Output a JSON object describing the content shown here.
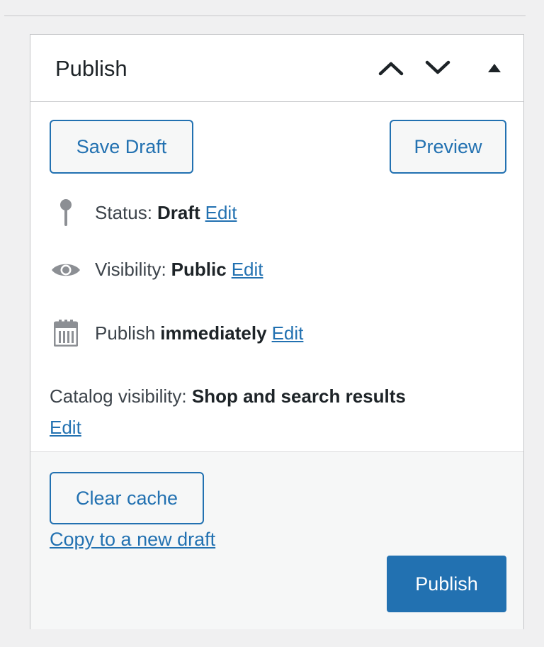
{
  "metabox": {
    "title": "Publish",
    "handles": {
      "move_up": "chevron-up-icon",
      "move_down": "chevron-down-icon",
      "toggle": "triangle-up-icon"
    }
  },
  "minor_actions": {
    "save_draft_label": "Save Draft",
    "preview_label": "Preview"
  },
  "misc": {
    "status": {
      "icon": "pin-icon",
      "label": "Status:",
      "value": "Draft",
      "edit": "Edit"
    },
    "visibility": {
      "icon": "eye-icon",
      "label": "Visibility:",
      "value": "Public",
      "edit": "Edit"
    },
    "publish": {
      "icon": "calendar-icon",
      "label": "Publish",
      "value": "immediately",
      "edit": "Edit"
    },
    "catalog": {
      "label": "Catalog visibility:",
      "value": "Shop and search results",
      "edit": "Edit"
    }
  },
  "major_actions": {
    "clear_cache_label": "Clear cache",
    "copy_draft_label": "Copy to a new draft",
    "publish_label": "Publish"
  },
  "colors": {
    "accent": "#2271b1",
    "icon_gray": "#8c8f94",
    "background": "#f0f0f1"
  }
}
